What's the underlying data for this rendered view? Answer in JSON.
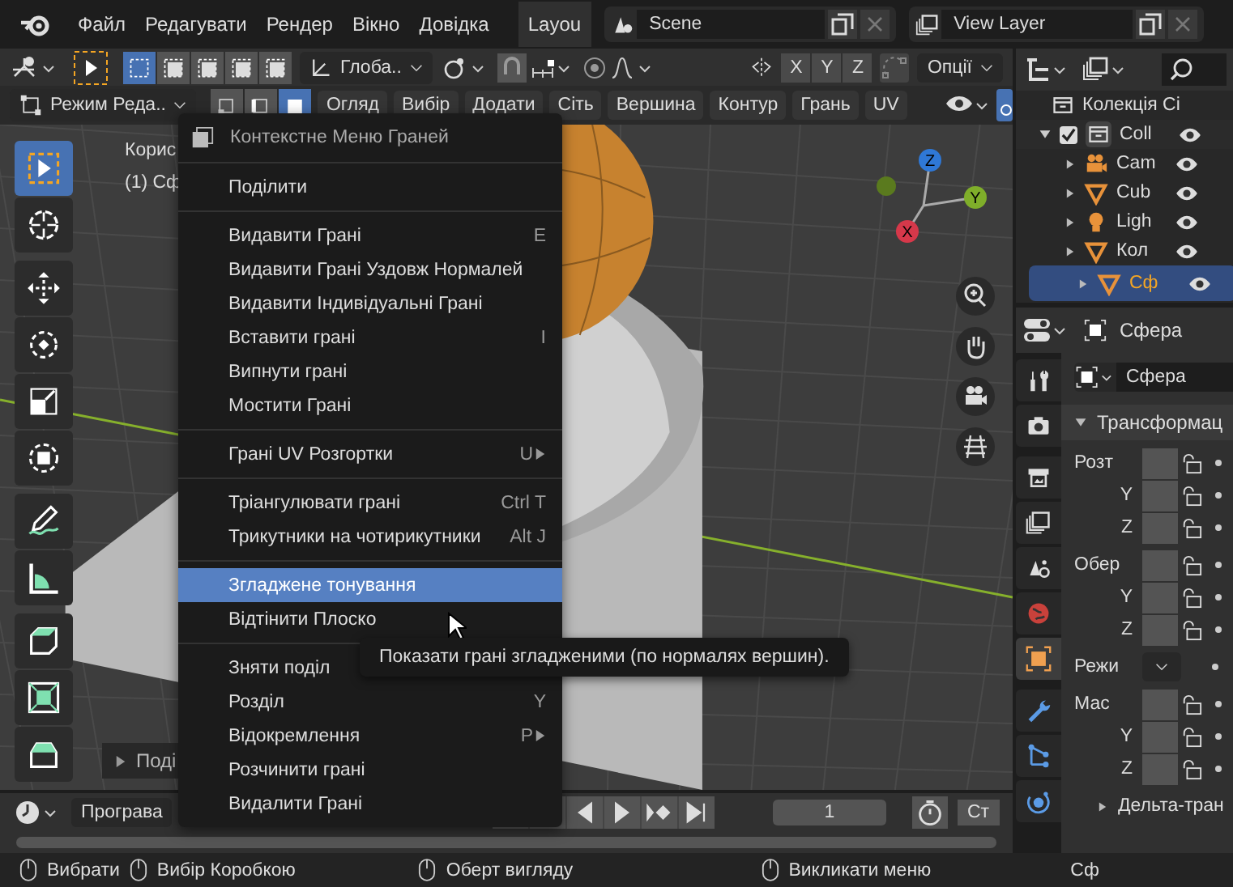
{
  "menubar": {
    "items": [
      "Файл",
      "Редагувати",
      "Рендер",
      "Вікно",
      "Довідка"
    ],
    "workspace_tab": "Layou",
    "scene": "Scene",
    "view_layer": "View Layer"
  },
  "tool_header": {
    "box_modes": [
      {
        "selected": true
      },
      {
        "selected": false
      },
      {
        "selected": false
      },
      {
        "selected": false
      },
      {
        "selected": false
      }
    ],
    "orientation": "Глоба..",
    "axes": [
      "X",
      "Y",
      "Z"
    ],
    "options": "Опції"
  },
  "header": {
    "mode": "Режим Реда..",
    "select_modes": [
      {
        "kind": "vertex",
        "selected": false
      },
      {
        "kind": "edge",
        "selected": false
      },
      {
        "kind": "face",
        "selected": true
      }
    ],
    "menus": [
      "Огляд",
      "Вибір",
      "Додати",
      "Сіть",
      "Вершина",
      "Контур",
      "Грань",
      "UV"
    ]
  },
  "viewport": {
    "view_name": "Корис",
    "object_info": "(1) Сф",
    "last_operator": "Поді",
    "gizmo_axes": [
      "X",
      "Y",
      "Z"
    ],
    "tools": [
      {
        "kind": "select",
        "selected": true
      },
      {
        "kind": "cursor",
        "selected": false
      },
      {
        "kind": "move",
        "selected": false
      },
      {
        "kind": "rotate",
        "selected": false
      },
      {
        "kind": "scale",
        "selected": false
      },
      {
        "kind": "transform",
        "selected": false
      },
      {
        "kind": "annotate",
        "selected": false
      },
      {
        "kind": "measure",
        "selected": false
      },
      {
        "kind": "extrude",
        "selected": false
      },
      {
        "kind": "inset",
        "selected": false
      },
      {
        "kind": "bevel",
        "selected": false
      }
    ]
  },
  "timeline": {
    "playback": "Програва",
    "frame": "1",
    "start_label": "Ст"
  },
  "outliner": {
    "scene_collection": "Колекція Сі",
    "items": [
      {
        "label": "Coll",
        "kind": "collection",
        "expanded": true,
        "checked": true,
        "selected": false,
        "children": [
          {
            "label": "Cam",
            "kind": "camera",
            "selected": false
          },
          {
            "label": "Cub",
            "kind": "mesh",
            "selected": false
          },
          {
            "label": "Ligh",
            "kind": "light",
            "selected": false
          },
          {
            "label": "Кол",
            "kind": "mesh",
            "selected": false
          },
          {
            "label": "Сф",
            "kind": "mesh",
            "selected": true
          }
        ]
      }
    ]
  },
  "properties": {
    "object_name": "Сфера",
    "name_field": "Сфера",
    "section": "Трансформац",
    "subsection": "Дельта-тран",
    "tabs": [
      {
        "kind": "tool",
        "selected": false
      },
      {
        "kind": "render",
        "selected": false
      },
      {
        "kind": "output",
        "selected": false
      },
      {
        "kind": "view_layer",
        "selected": false
      },
      {
        "kind": "scene",
        "selected": false
      },
      {
        "kind": "world",
        "selected": false
      },
      {
        "kind": "object",
        "selected": true
      },
      {
        "kind": "modifier",
        "selected": false
      },
      {
        "kind": "particles",
        "selected": false
      },
      {
        "kind": "physics",
        "selected": false
      }
    ],
    "groups": [
      [
        {
          "label": "Розт",
          "kind": "field"
        },
        {
          "label": "Y",
          "kind": "field"
        },
        {
          "label": "Z",
          "kind": "field"
        }
      ],
      [
        {
          "label": "Обер",
          "kind": "field"
        },
        {
          "label": "Y",
          "kind": "field"
        },
        {
          "label": "Z",
          "kind": "field"
        }
      ],
      [
        {
          "label": "Режи",
          "kind": "dropdown"
        }
      ],
      [
        {
          "label": "Мас",
          "kind": "field"
        },
        {
          "label": "Y",
          "kind": "field"
        },
        {
          "label": "Z",
          "kind": "field"
        }
      ]
    ]
  },
  "context_menu": {
    "title": "Контекстне Меню Граней",
    "groups": [
      [
        {
          "label": "Поділити",
          "submenu": false,
          "selected": false
        }
      ],
      [
        {
          "label": "Видавити Грані",
          "shortcut": "E",
          "submenu": false,
          "selected": false
        },
        {
          "label": "Видавити Грані Уздовж Нормалей",
          "submenu": false,
          "selected": false
        },
        {
          "label": "Видавити Індивідуальні Грані",
          "submenu": false,
          "selected": false
        },
        {
          "label": "Вставити грані",
          "shortcut": "I",
          "submenu": false,
          "selected": false
        },
        {
          "label": "Випнути грані",
          "submenu": false,
          "selected": false
        },
        {
          "label": "Мостити Грані",
          "submenu": false,
          "selected": false
        }
      ],
      [
        {
          "label": "Грані UV Розгортки",
          "shortcut": "U",
          "submenu": true,
          "selected": false
        }
      ],
      [
        {
          "label": "Тріангулювати грані",
          "shortcut": "Ctrl T",
          "submenu": false,
          "selected": false
        },
        {
          "label": "Трикутники на чотирикутники",
          "shortcut": "Alt J",
          "submenu": false,
          "selected": false
        }
      ],
      [
        {
          "label": "Згладжене тонування",
          "submenu": false,
          "selected": true
        },
        {
          "label": "Відтінити Плоско",
          "submenu": false,
          "selected": false
        }
      ],
      [
        {
          "label": "Зняти поділ",
          "submenu": false,
          "selected": false
        },
        {
          "label": "Розділ",
          "shortcut": "Y",
          "submenu": false,
          "selected": false
        },
        {
          "label": "Відокремлення",
          "shortcut": "P",
          "submenu": true,
          "selected": false
        },
        {
          "label": "Розчинити грані",
          "submenu": false,
          "selected": false
        },
        {
          "label": "Видалити Грані",
          "submenu": false,
          "selected": false
        }
      ]
    ]
  },
  "tooltip": "Показати грані згладженими (по нормалях вершин).",
  "status_bar": [
    "Вибрати",
    "Вибір Коробкою",
    "Оберт вигляду",
    "Викликати меню",
    "Сф"
  ]
}
